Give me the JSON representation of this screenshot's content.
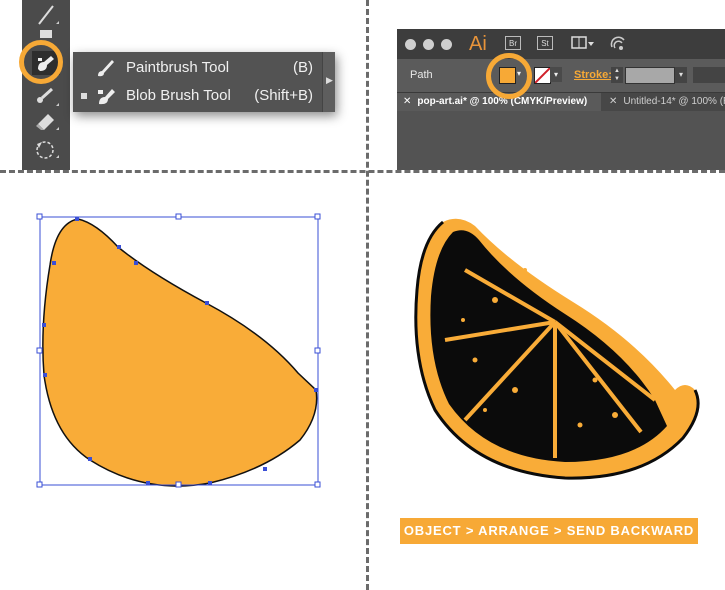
{
  "flyout_menu": {
    "items": [
      {
        "label": "Paintbrush Tool",
        "shortcut": "(B)",
        "selected": false,
        "icon": "paintbrush-icon"
      },
      {
        "label": "Blob Brush Tool",
        "shortcut": "(Shift+B)",
        "selected": true,
        "icon": "blob-brush-icon"
      }
    ]
  },
  "toolbar": {
    "tools": [
      "line-segment-icon",
      "rectangle-icon",
      "blob-brush-icon",
      "eyedropper-icon",
      "eraser-icon",
      "rotate-icon"
    ]
  },
  "app_window": {
    "logo": "Ai",
    "bridge_button": "Br",
    "stock_button": "St",
    "control_bar": {
      "selection_label": "Path",
      "fill_color": "#f7a936",
      "stroke_label": "Stroke:"
    },
    "tabs": [
      {
        "label": "pop-art.ai* @ 100% (CMYK/Preview)",
        "active": true
      },
      {
        "label": "Untitled-14* @ 100% (R",
        "active": false
      }
    ]
  },
  "caption": "OBJECT > ARRANGE > SEND BACKWARD",
  "colors": {
    "accent": "#f7a936",
    "panel_dark": "#4b4b4b",
    "selection_blue": "#3a4fd6"
  }
}
